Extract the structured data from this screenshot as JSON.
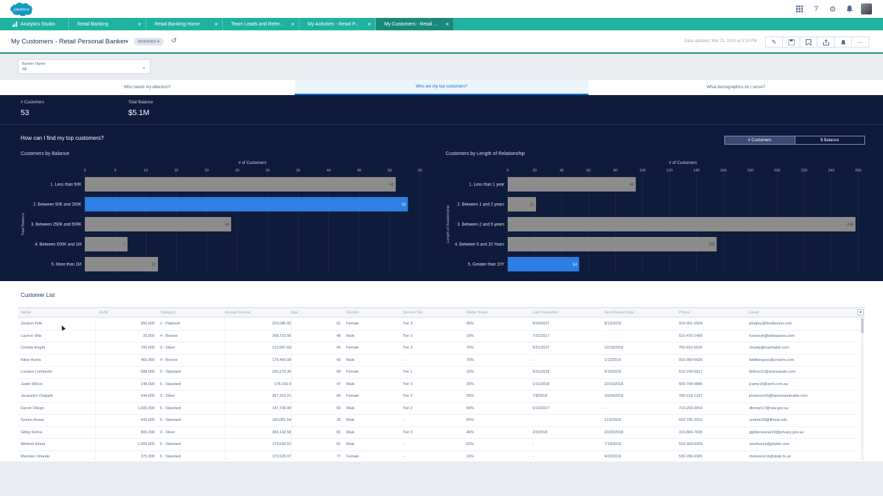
{
  "app": {
    "logo_text": "salesforce",
    "logo_color": "#1798c1",
    "icons": [
      "apps-grid-icon",
      "help-icon",
      "gear-icon",
      "bell-icon"
    ]
  },
  "tabs": [
    {
      "label": "Analytics Studio",
      "active": false
    },
    {
      "label": "Retail Banking",
      "active": false
    },
    {
      "label": "Retail Banking Home",
      "active": false
    },
    {
      "label": "Team Leads and Refer...",
      "active": false
    },
    {
      "label": "My Activities - Retail P...",
      "active": false
    },
    {
      "label": "My Customers - Retail ...",
      "active": true
    }
  ],
  "header": {
    "title": "My Customers - Retail Personal Banker",
    "badge": "MODIFIED",
    "updated": "Data updated: Mar 21, 2019 at 5:16 PM"
  },
  "filter": {
    "label": "Banker Name",
    "value": "All"
  },
  "section_tabs": [
    {
      "label": "Who needs my attention?",
      "active": false
    },
    {
      "label": "Who are my top customers?",
      "active": true
    },
    {
      "label": "What demographics do I serve?",
      "active": false
    }
  ],
  "kpis": [
    {
      "label": "# Customers",
      "value": "53"
    },
    {
      "label": "Total Balance",
      "value": "$5.1M"
    }
  ],
  "dashboard": {
    "question": "How can I find my top customers?",
    "toggle": [
      "# Customers",
      "$ Balance"
    ]
  },
  "chart_data": [
    {
      "type": "bar",
      "title": "Customers by Balance",
      "xlabel": "# of Customers",
      "ylabel": "Total Balance",
      "orientation": "horizontal",
      "xlim": [
        0,
        55
      ],
      "ticks": [
        0,
        5,
        10,
        15,
        20,
        25,
        30,
        35,
        40,
        45,
        50,
        55
      ],
      "categories": [
        "1. Less than 50K",
        "2. Between 50K and 250K",
        "3. Between 250K and 500K",
        "4. Between 500K and 1M",
        "5. More than 1M"
      ],
      "values": [
        51,
        53,
        24,
        7,
        12
      ],
      "highlight_index": 1,
      "bar_color": "#8c8c8c",
      "highlight_color": "#2f7ee3"
    },
    {
      "type": "bar",
      "title": "Customers by Length of Relationship",
      "xlabel": "# of Customers",
      "ylabel": "Length of Relationship",
      "orientation": "horizontal",
      "xlim": [
        0,
        260
      ],
      "ticks": [
        0,
        20,
        40,
        60,
        80,
        100,
        120,
        140,
        160,
        180,
        200,
        220,
        240,
        260
      ],
      "categories": [
        "1. Less than 1 year",
        "2. Between 1 and 2 years",
        "3. Between 2 and 5 years",
        "4. Between 5 and 10 Years",
        "5. Greater than 10Y"
      ],
      "values": [
        95,
        21,
        258,
        155,
        53
      ],
      "highlight_index": 4,
      "bar_color": "#8c8c8c",
      "highlight_color": "#2f7ee3"
    }
  ],
  "customer_list": {
    "title": "Customer List",
    "columns": [
      "Name",
      "AUM",
      "Category",
      "Annual Income",
      "Age",
      "Gender",
      "Service Tier",
      "Wallet Share",
      "Last Interaction",
      "Next Renew Date",
      "Phone",
      "Email"
    ],
    "rows": [
      [
        "Joelynn Polk",
        "900,000",
        "1 - Platinum",
        "203,685.92",
        "61",
        "Female",
        "Tier 3",
        "45%",
        "8/19/2017",
        "8/13/2019",
        "916-901-5564",
        "jkingley@feedburner.com"
      ],
      [
        "Launce Villa",
        "35,000",
        "4 - Bronze",
        "268,710.95",
        "48",
        "Male",
        "Tier 3",
        "18%",
        "7/31/2017",
        "-",
        "510-475-1499",
        "lcooneyk@wikispaces.com"
      ],
      [
        "Coretta Knight",
        "700,000",
        "3 - Silver",
        "210,587.69",
        "45",
        "Female",
        "Tier 3",
        "70%",
        "5/21/2017",
        "12/18/2018",
        "760-815-0626",
        "chuetp@mashable.com"
      ],
      [
        "Kilian Burris",
        "465,999",
        "4 - Bronze",
        "178,460.08",
        "40",
        "Male",
        "-",
        "70%",
        "-",
        "1/12/2019",
        "916-983-6026",
        "kdelbergues@crowire.com"
      ],
      [
        "Luciana Lombardo",
        "588,000",
        "5 - Standard",
        "206,279.36",
        "68",
        "Female",
        "Tier 1",
        "10%",
        "5/31/2018",
        "9/10/2019",
        "510-243-5917",
        "lbillson11@shareasale.com"
      ],
      [
        "Justin Wilcox",
        "148,000",
        "5 - Standard",
        "178,160.9",
        "47",
        "Male",
        "Tier 3",
        "20%",
        "1/21/2018",
        "10/16/2018",
        "559-794-0885",
        "jcame14@smh.com.au"
      ],
      [
        "Jacquelyn Chapple",
        "544,500",
        "3 - Silver",
        "357,319.21",
        "66",
        "Female",
        "Tier 3",
        "55%",
        "7/8/2018",
        "10/24/2018",
        "760-218-1237",
        "jmowrow16@barnesandnoble.com"
      ],
      [
        "Darvie Villego",
        "1,600,000",
        "5 - Standard",
        "147,738.49",
        "83",
        "Male",
        "Tier 2",
        "80%",
        "5/10/2017",
        "-",
        "714-203-0054",
        "dbrown17@nsw.gov.au"
      ],
      [
        "Symon Anwar",
        "643,500",
        "5 - Standard",
        "190,081.54",
        "35",
        "Male",
        "-",
        "65%",
        "",
        "11/3/2018",
        "602-795-3310",
        "sedrein18@illinois.edu"
      ],
      [
        "Gibby Rohra",
        "800,000",
        "3 - Silver",
        "383,142.58",
        "81",
        "Male",
        "Tier 3",
        "40%",
        "2/3/2018",
        "10/20/2018",
        "310-869-7635",
        "ggildersleeve19@privacy.gov.au"
      ],
      [
        "Winfred Hirata",
        "1,550,000",
        "5 - Standard",
        "173,543.52",
        "81",
        "Male",
        "-",
        "62%",
        "-",
        "7/19/2019",
        "510-469-6309",
        "wwelius1a@phpbb.com"
      ],
      [
        "Melodee Orlando",
        "375,000",
        "5 - Standard",
        "170,528.07",
        "77",
        "Female",
        "-",
        "16%",
        "-",
        "4/22/2019",
        "530-286-6305",
        "mstevens1b@state.tx.us"
      ]
    ]
  }
}
